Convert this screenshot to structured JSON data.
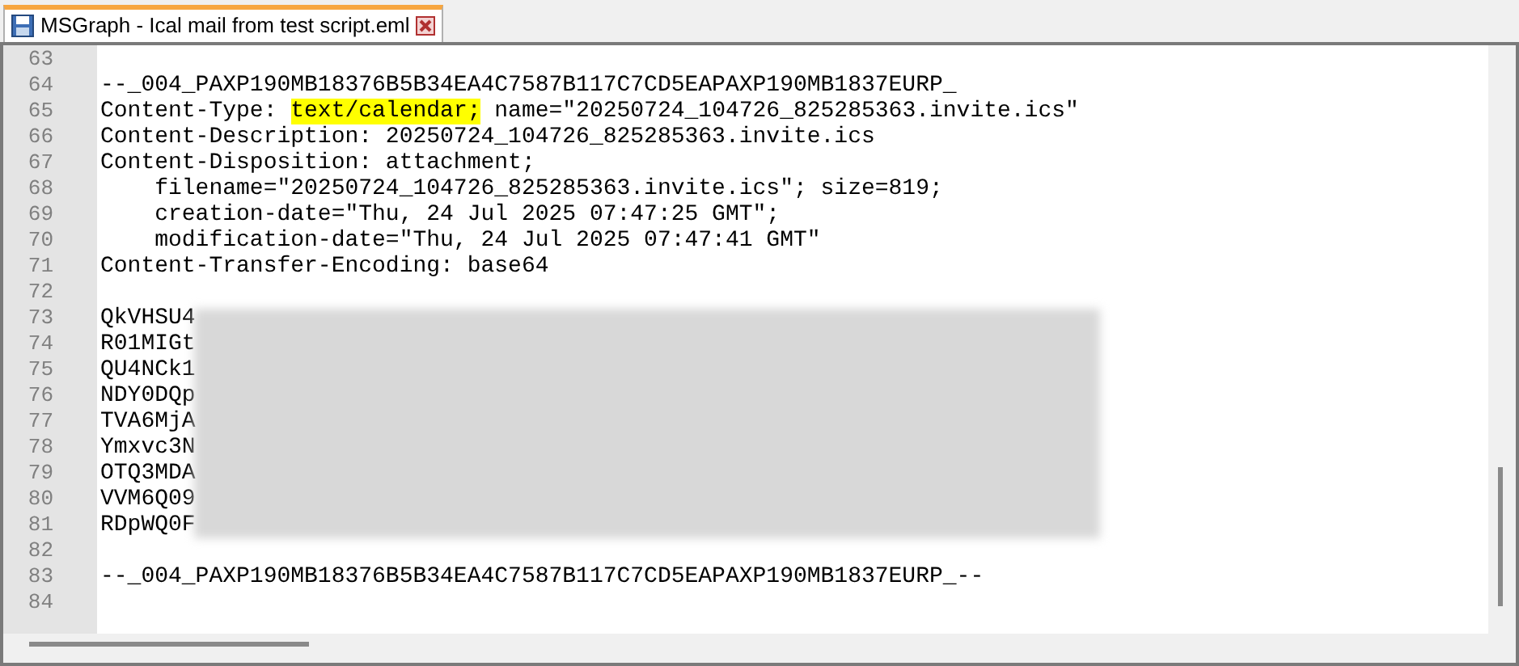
{
  "tabs": [
    {
      "title": "MSGraph - Ical mail from test script.eml",
      "selected": true
    }
  ],
  "editor": {
    "lines": [
      {
        "number": "63"
      },
      {
        "number": "64",
        "segments": [
          {
            "text": "--_004_PAXP190MB18376B5B34EA4C7587B117C7CD5EAPAXP190MB1837EURP_",
            "highlighted": false
          }
        ]
      },
      {
        "number": "65",
        "segments": [
          {
            "text": "Content-Type: ",
            "highlighted": false
          },
          {
            "text": "text/calendar;",
            "highlighted": true
          },
          {
            "text": " name=\"20250724_104726_825285363.invite.ics\"",
            "highlighted": false
          }
        ]
      },
      {
        "number": "66",
        "segments": [
          {
            "text": "Content-Description: 20250724_104726_825285363.invite.ics",
            "highlighted": false
          }
        ]
      },
      {
        "number": "67",
        "segments": [
          {
            "text": "Content-Disposition: attachment;",
            "highlighted": false
          }
        ]
      },
      {
        "number": "68",
        "segments": [
          {
            "text": "    filename=\"20250724_104726_825285363.invite.ics\"; size=819;",
            "highlighted": false
          }
        ]
      },
      {
        "number": "69",
        "segments": [
          {
            "text": "    creation-date=\"Thu, 24 Jul 2025 07:47:25 GMT\";",
            "highlighted": false
          }
        ]
      },
      {
        "number": "70",
        "segments": [
          {
            "text": "    modification-date=\"Thu, 24 Jul 2025 07:47:41 GMT\"",
            "highlighted": false
          }
        ]
      },
      {
        "number": "71",
        "segments": [
          {
            "text": "Content-Transfer-Encoding: base64",
            "highlighted": false
          }
        ]
      },
      {
        "number": "72"
      },
      {
        "number": "73",
        "segments": [
          {
            "text": "QkVHSU4",
            "highlighted": false
          }
        ]
      },
      {
        "number": "74",
        "segments": [
          {
            "text": "R01MIGt",
            "highlighted": false
          }
        ]
      },
      {
        "number": "75",
        "segments": [
          {
            "text": "QU4NCk1",
            "highlighted": false
          }
        ]
      },
      {
        "number": "76",
        "segments": [
          {
            "text": "NDY0DQp",
            "highlighted": false
          }
        ]
      },
      {
        "number": "77",
        "segments": [
          {
            "text": "TVA6MjA",
            "highlighted": false
          }
        ]
      },
      {
        "number": "78",
        "segments": [
          {
            "text": "Ymxvc3N",
            "highlighted": false
          }
        ]
      },
      {
        "number": "79",
        "segments": [
          {
            "text": "OTQ3MDA",
            "highlighted": false
          }
        ]
      },
      {
        "number": "80",
        "segments": [
          {
            "text": "VVM6Q09",
            "highlighted": false
          }
        ]
      },
      {
        "number": "81",
        "segments": [
          {
            "text": "RDpWQ0F",
            "highlighted": false
          }
        ]
      },
      {
        "number": "82"
      },
      {
        "number": "83",
        "segments": [
          {
            "text": "--_004_PAXP190MB18376B5B34EA4C7587B117C7CD5EAPAXP190MB1837EURP_--",
            "highlighted": false
          }
        ]
      },
      {
        "number": "84"
      }
    ]
  }
}
